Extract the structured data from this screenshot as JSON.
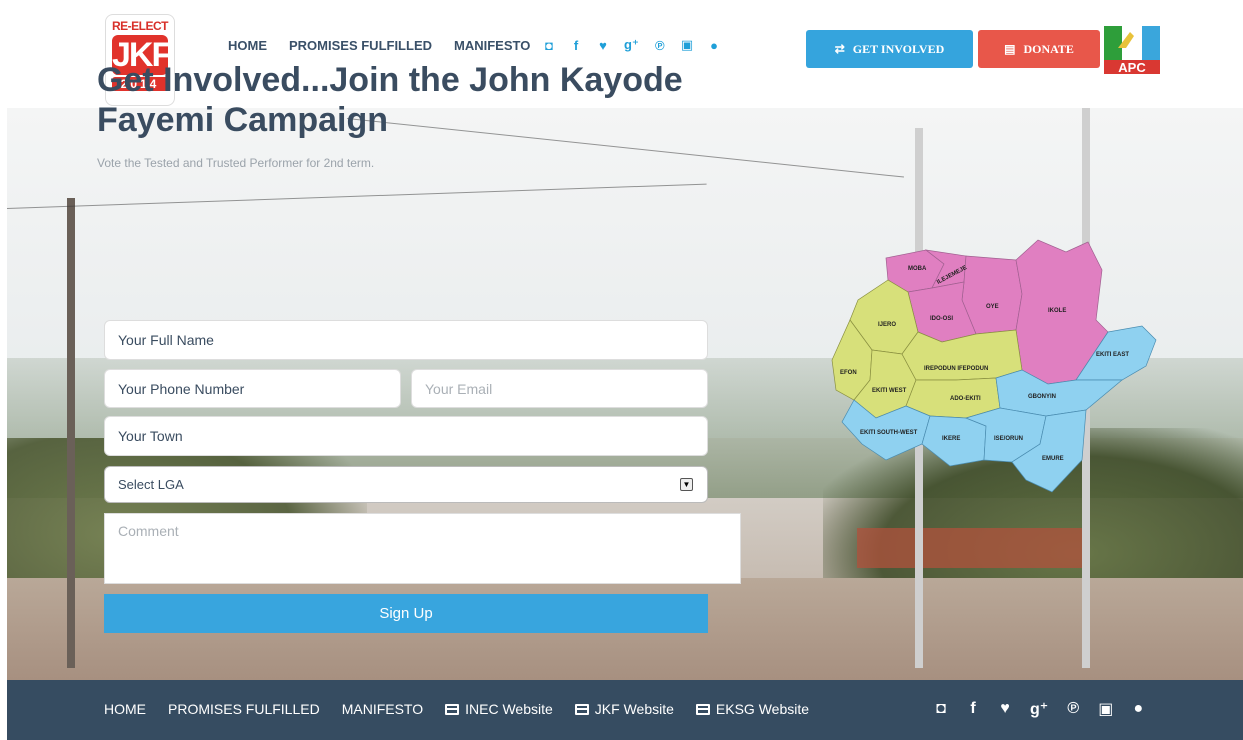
{
  "header": {
    "logo": {
      "top": "RE-ELECT",
      "main": "JKF",
      "year": "2014"
    },
    "nav": [
      "HOME",
      "PROMISES FULFILLED",
      "MANIFESTO"
    ],
    "social_icons": [
      "instagram-icon",
      "facebook-icon",
      "twitter-icon",
      "google-plus-icon",
      "pinterest-icon",
      "youtube-icon",
      "chat-icon"
    ],
    "get_involved_label": "GET INVOLVED",
    "donate_label": "DONATE",
    "party_logo": "APC"
  },
  "hero": {
    "title": "Get Involved...Join the John Kayode Fayemi Campaign",
    "subtitle": "Vote the Tested and Trusted Performer for 2nd term."
  },
  "form": {
    "full_name": "Your Full Name",
    "phone": "Your Phone Number",
    "email_placeholder": "Your Email",
    "town": "Your Town",
    "lga_selected": "Select LGA",
    "comment_placeholder": "Comment",
    "submit_label": "Sign Up"
  },
  "map": {
    "regions": [
      "MOBA",
      "ILEJEMEJE",
      "OYE",
      "IKOLE",
      "IDO-OSI",
      "IJERO",
      "EKITI EAST",
      "EFON",
      "IREPODUN IFEPODUN",
      "EKITI WEST",
      "ADO-EKITI",
      "GBONYIN",
      "EKITI SOUTH-WEST",
      "IKERE",
      "ISE/ORUN",
      "EMURE"
    ],
    "colors": {
      "pink": "#e07fc1",
      "yellow": "#d7e07a",
      "blue": "#8fd1f0"
    }
  },
  "footer": {
    "nav": [
      "HOME",
      "PROMISES FULFILLED",
      "MANIFESTO"
    ],
    "links": [
      "INEC Website",
      "JKF Website",
      "EKSG Website"
    ],
    "social_icons": [
      "instagram-icon",
      "facebook-icon",
      "twitter-icon",
      "google-plus-icon",
      "pinterest-icon",
      "youtube-icon",
      "chat-icon"
    ]
  }
}
